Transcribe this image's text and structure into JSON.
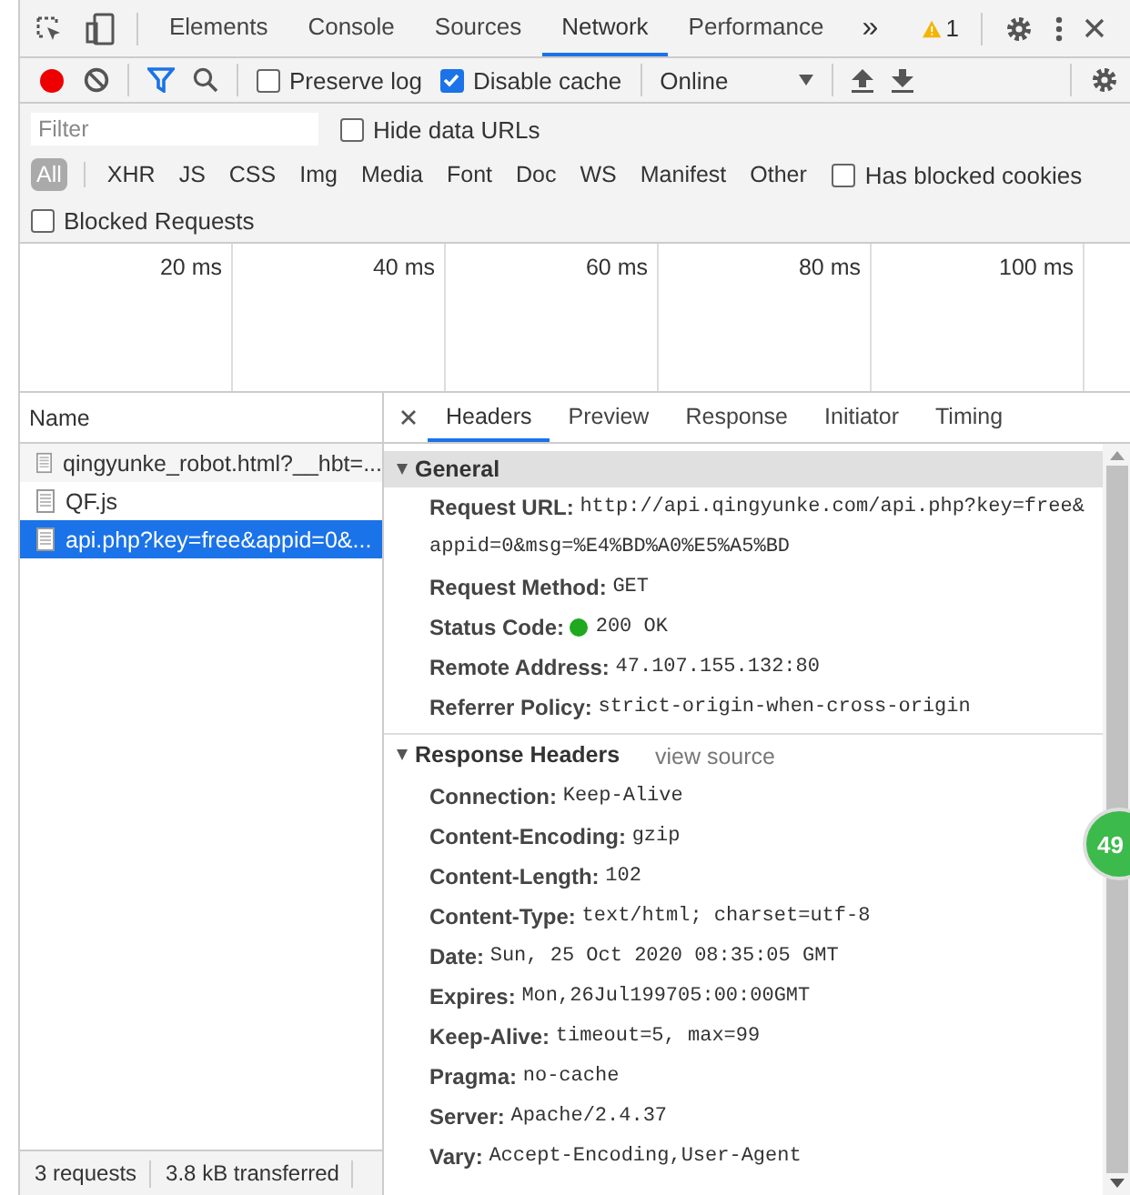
{
  "main_tabs": [
    {
      "label": "Elements",
      "selected": false
    },
    {
      "label": "Console",
      "selected": false
    },
    {
      "label": "Sources",
      "selected": false
    },
    {
      "label": "Network",
      "selected": true
    },
    {
      "label": "Performance",
      "selected": false
    }
  ],
  "more_tabs": "»",
  "warning_count": "1",
  "toolbar": {
    "recording": true,
    "preserve_log": {
      "label": "Preserve log",
      "checked": false
    },
    "disable_cache": {
      "label": "Disable cache",
      "checked": true
    },
    "throttling": "Online"
  },
  "filter": {
    "placeholder": "Filter",
    "hide_data_urls": {
      "label": "Hide data URLs",
      "checked": false
    },
    "types": [
      {
        "label": "All",
        "selected": true
      },
      {
        "label": "XHR",
        "selected": false
      },
      {
        "label": "JS",
        "selected": false
      },
      {
        "label": "CSS",
        "selected": false
      },
      {
        "label": "Img",
        "selected": false
      },
      {
        "label": "Media",
        "selected": false
      },
      {
        "label": "Font",
        "selected": false
      },
      {
        "label": "Doc",
        "selected": false
      },
      {
        "label": "WS",
        "selected": false
      },
      {
        "label": "Manifest",
        "selected": false
      },
      {
        "label": "Other",
        "selected": false
      }
    ],
    "has_blocked_cookies": {
      "label": "Has blocked cookies",
      "checked": false
    },
    "blocked_requests": {
      "label": "Blocked Requests",
      "checked": false
    }
  },
  "timeline": {
    "ticks": [
      "20 ms",
      "40 ms",
      "60 ms",
      "80 ms",
      "100 ms"
    ]
  },
  "requests": {
    "column": "Name",
    "rows": [
      {
        "name": "qingyunke_robot.html?__hbt=...",
        "selected": false
      },
      {
        "name": "QF.js",
        "selected": false
      },
      {
        "name": "api.php?key=free&appid=0&...",
        "selected": true
      }
    ]
  },
  "status_bar": [
    "3 requests",
    "3.8 kB transferred"
  ],
  "detail_tabs": [
    {
      "label": "Headers",
      "selected": true
    },
    {
      "label": "Preview",
      "selected": false
    },
    {
      "label": "Response",
      "selected": false
    },
    {
      "label": "Initiator",
      "selected": false
    },
    {
      "label": "Timing",
      "selected": false
    }
  ],
  "sections": [
    {
      "title": "General",
      "expanded": true,
      "rows": [
        {
          "key": "Request URL:",
          "value": "http://api.qingyunke.com/api.php?key=free&appid=0&msg=%E4%BD%A0%E5%A5%BD"
        },
        {
          "key": "Request Method:",
          "value": "GET"
        },
        {
          "key": "Status Code:",
          "value": "200 OK",
          "status_dot": true
        },
        {
          "key": "Remote Address:",
          "value": "47.107.155.132:80"
        },
        {
          "key": "Referrer Policy:",
          "value": "strict-origin-when-cross-origin"
        }
      ]
    },
    {
      "title": "Response Headers",
      "expanded": true,
      "link": "view source",
      "rows": [
        {
          "key": "Connection:",
          "value": "Keep-Alive"
        },
        {
          "key": "Content-Encoding:",
          "value": "gzip"
        },
        {
          "key": "Content-Length:",
          "value": "102"
        },
        {
          "key": "Content-Type:",
          "value": "text/html; charset=utf-8"
        },
        {
          "key": "Date:",
          "value": "Sun, 25 Oct 2020 08:35:05 GMT"
        },
        {
          "key": "Expires:",
          "value": "Mon,26Jul199705:00:00GMT"
        },
        {
          "key": "Keep-Alive:",
          "value": "timeout=5, max=99"
        },
        {
          "key": "Pragma:",
          "value": "no-cache"
        },
        {
          "key": "Server:",
          "value": "Apache/2.4.37"
        },
        {
          "key": "Vary:",
          "value": "Accept-Encoding,User-Agent"
        }
      ]
    }
  ],
  "floating_badge": "49"
}
